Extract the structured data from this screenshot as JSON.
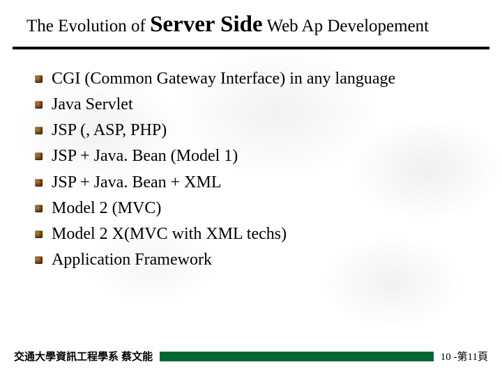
{
  "title": {
    "pre": "The Evolution of ",
    "em": "Server Side",
    "post": " Web Ap Developement"
  },
  "bullets": [
    "CGI (Common Gateway Interface) in any language",
    "Java Servlet",
    "JSP (, ASP, PHP)",
    "JSP + Java. Bean (Model 1)",
    "JSP + Java. Bean + XML",
    "Model 2 (MVC)",
    "Model 2 X(MVC with XML techs)",
    "Application Framework"
  ],
  "footer": {
    "left": "交通大學資訊工程學系 蔡文能",
    "right": "10 -第11頁"
  },
  "colors": {
    "footer_bar": "#006633"
  }
}
